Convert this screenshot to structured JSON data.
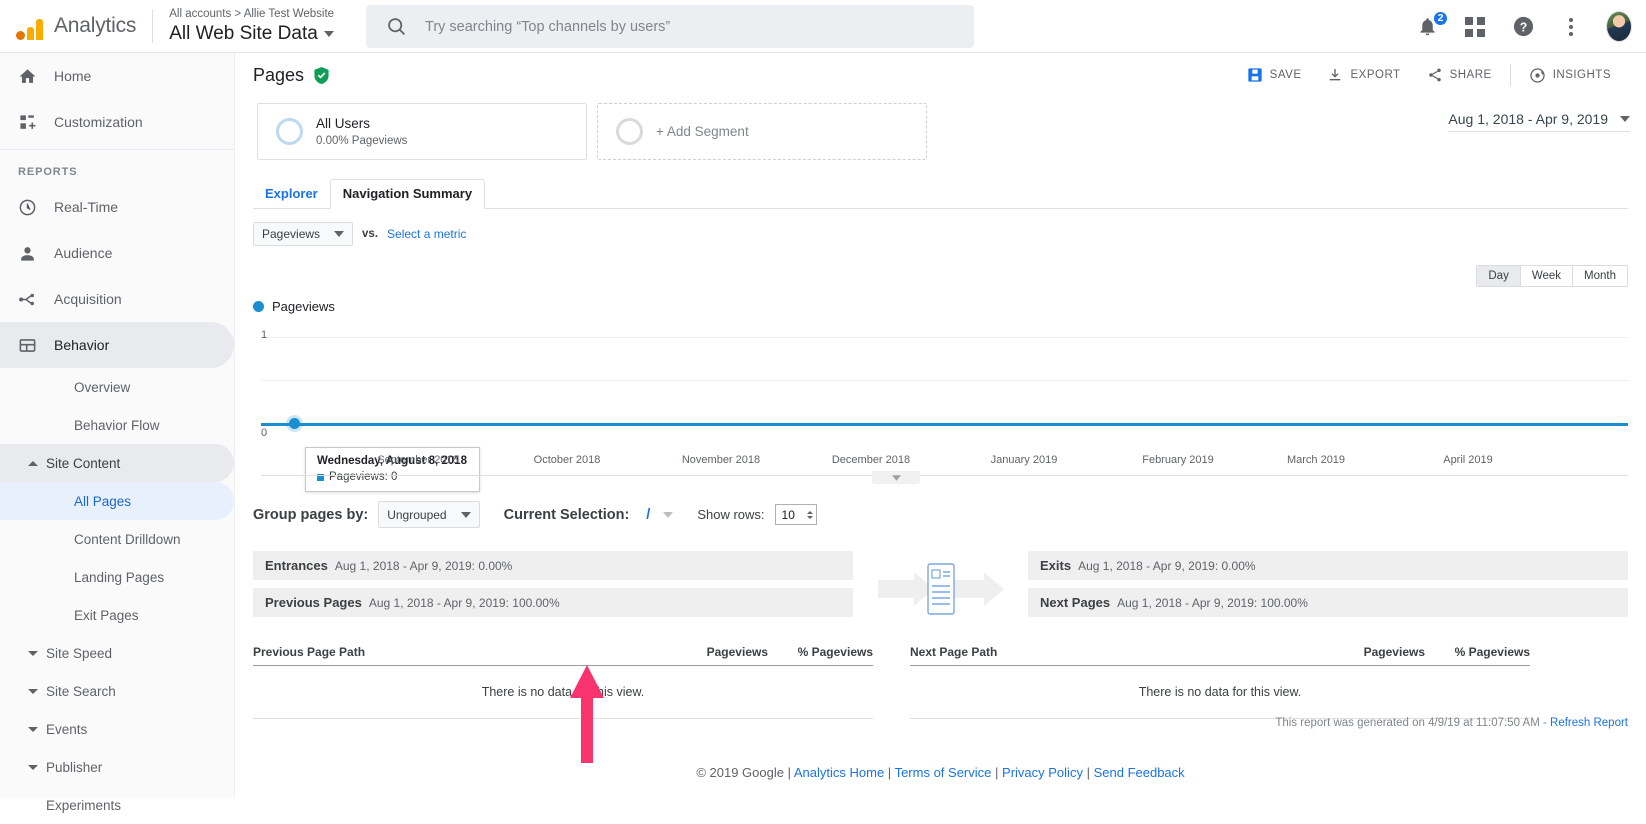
{
  "topbar": {
    "logo_text": "Analytics",
    "account_breadcrumb": "All accounts > Allie Test Website",
    "view_name": "All Web Site Data",
    "search_placeholder": "Try searching “Top channels by users”",
    "notifications_count": "2"
  },
  "sidebar": {
    "primary": [
      {
        "label": "Home",
        "icon": "home-icon"
      },
      {
        "label": "Customization",
        "icon": "customization-icon"
      }
    ],
    "section_label": "REPORTS",
    "reports": [
      {
        "label": "Real-Time",
        "icon": "clock-icon"
      },
      {
        "label": "Audience",
        "icon": "person-icon"
      },
      {
        "label": "Acquisition",
        "icon": "acquisition-icon"
      },
      {
        "label": "Behavior",
        "icon": "behavior-icon"
      }
    ],
    "behavior_children": [
      {
        "label": "Overview",
        "type": "leaf"
      },
      {
        "label": "Behavior Flow",
        "type": "leaf"
      },
      {
        "label": "Site Content",
        "type": "group",
        "expanded": true
      },
      {
        "label": "All Pages",
        "type": "leaf",
        "selected": true
      },
      {
        "label": "Content Drilldown",
        "type": "leaf"
      },
      {
        "label": "Landing Pages",
        "type": "leaf"
      },
      {
        "label": "Exit Pages",
        "type": "leaf"
      },
      {
        "label": "Site Speed",
        "type": "group",
        "expanded": false
      },
      {
        "label": "Site Search",
        "type": "group",
        "expanded": false
      },
      {
        "label": "Events",
        "type": "group",
        "expanded": false
      },
      {
        "label": "Publisher",
        "type": "group",
        "expanded": false
      },
      {
        "label": "Experiments",
        "type": "leaf"
      }
    ]
  },
  "page": {
    "title": "Pages",
    "actions": [
      {
        "label": "SAVE",
        "icon": "save-icon"
      },
      {
        "label": "EXPORT",
        "icon": "export-icon"
      },
      {
        "label": "SHARE",
        "icon": "share-icon"
      },
      {
        "label": "INSIGHTS",
        "icon": "insights-icon"
      }
    ],
    "date_range": "Aug 1, 2018 - Apr 9, 2019"
  },
  "segments": {
    "applied": {
      "name": "All Users",
      "detail": "0.00% Pageviews"
    },
    "add_label": "+ Add Segment"
  },
  "tabs": [
    {
      "label": "Explorer",
      "active": false
    },
    {
      "label": "Navigation Summary",
      "active": true
    }
  ],
  "metric_controls": {
    "metric": "Pageviews",
    "vs_label": "vs.",
    "select_metric": "Select a metric",
    "granularity": [
      {
        "label": "Day",
        "active": true
      },
      {
        "label": "Week",
        "active": false
      },
      {
        "label": "Month",
        "active": false
      }
    ]
  },
  "chart_data": {
    "type": "line",
    "title": "Pageviews",
    "legend": [
      "Pageviews"
    ],
    "legend_position": "top-left",
    "ylabel": "",
    "xlabel": "",
    "ylim": [
      0,
      1
    ],
    "ytick_labels": [
      "0",
      "1"
    ],
    "grid": true,
    "x": [
      "September 2018",
      "October 2018",
      "November 2018",
      "December 2018",
      "January 2019",
      "February 2019",
      "March 2019",
      "April 2019"
    ],
    "series": [
      {
        "name": "Pageviews",
        "color": "#1a8ed1",
        "values": [
          0,
          0,
          0,
          0,
          0,
          0,
          0,
          0
        ]
      }
    ],
    "tooltip": {
      "date": "Wednesday, August 8, 2018",
      "metric_label": "Pageviews",
      "value": "0",
      "line": "Pageviews: 0"
    }
  },
  "controls": {
    "group_pages_by_label": "Group pages by:",
    "group_pages_by_value": "Ungrouped",
    "current_selection_label": "Current Selection:",
    "current_selection_value": "/",
    "show_rows_label": "Show rows:",
    "show_rows_value": "10"
  },
  "nav_summary": {
    "entrances": {
      "key": "Entrances",
      "value": "Aug 1, 2018 - Apr 9, 2019: 0.00%"
    },
    "exits": {
      "key": "Exits",
      "value": "Aug 1, 2018 - Apr 9, 2019: 0.00%"
    },
    "previous_pages": {
      "key": "Previous Pages",
      "value": "Aug 1, 2018 - Apr 9, 2019: 100.00%"
    },
    "next_pages": {
      "key": "Next Pages",
      "value": "Aug 1, 2018 - Apr 9, 2019: 100.00%"
    }
  },
  "tables": {
    "previous": {
      "headers": [
        "Previous Page Path",
        "Pageviews",
        "% Pageviews"
      ],
      "empty_message": "There is no data for this view."
    },
    "next": {
      "headers": [
        "Next Page Path",
        "Pageviews",
        "% Pageviews"
      ],
      "empty_message": "There is no data for this view."
    }
  },
  "report_meta": {
    "generated_text": "This report was generated on 4/9/19 at 11:07:50 AM -",
    "refresh_label": "Refresh Report"
  },
  "footer": {
    "copyright": "© 2019 Google |",
    "links": [
      "Analytics Home",
      "Terms of Service",
      "Privacy Policy",
      "Send Feedback"
    ],
    "separator": "|"
  }
}
